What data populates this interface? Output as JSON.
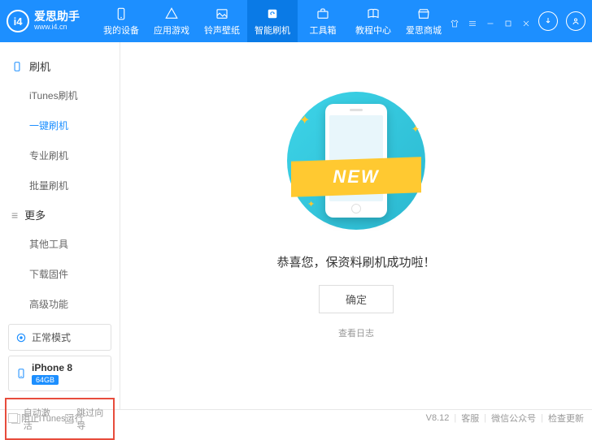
{
  "app": {
    "name": "爱思助手",
    "url": "www.i4.cn"
  },
  "nav": [
    {
      "label": "我的设备"
    },
    {
      "label": "应用游戏"
    },
    {
      "label": "铃声壁纸"
    },
    {
      "label": "智能刷机"
    },
    {
      "label": "工具箱"
    },
    {
      "label": "教程中心"
    },
    {
      "label": "爱思商城"
    }
  ],
  "sidebar": {
    "group1": "刷机",
    "items1": [
      "iTunes刷机",
      "一键刷机",
      "专业刷机",
      "批量刷机"
    ],
    "group2": "更多",
    "items2": [
      "其他工具",
      "下载固件",
      "高级功能"
    ],
    "status": "正常模式",
    "device": {
      "name": "iPhone 8",
      "storage": "64GB"
    },
    "check1": "自动激活",
    "check2": "跳过向导"
  },
  "main": {
    "ribbon": "NEW",
    "message": "恭喜您，保资料刷机成功啦！",
    "ok": "确定",
    "log": "查看日志"
  },
  "footer": {
    "block": "阻止iTunes运行",
    "version": "V8.12",
    "l1": "客服",
    "l2": "微信公众号",
    "l3": "检查更新"
  }
}
